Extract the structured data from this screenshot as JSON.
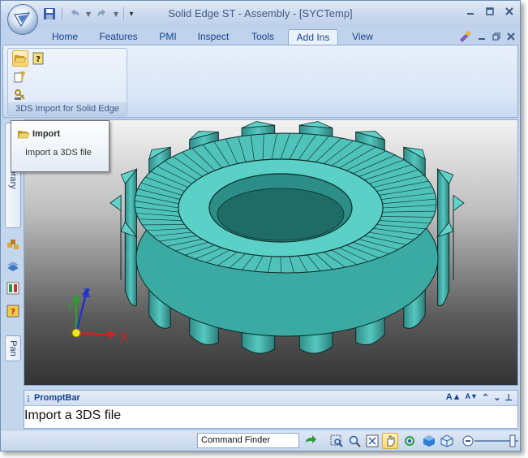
{
  "window": {
    "title": "Solid Edge ST - Assembly - [SYCTemp]"
  },
  "tabs": [
    {
      "label": "Home",
      "active": false
    },
    {
      "label": "Features",
      "active": false
    },
    {
      "label": "PMI",
      "active": false
    },
    {
      "label": "Inspect",
      "active": false
    },
    {
      "label": "Tools",
      "active": false
    },
    {
      "label": "Add Ins",
      "active": true
    },
    {
      "label": "View",
      "active": false
    }
  ],
  "ribbon": {
    "group_label": "3DS Import for Solid Edge",
    "buttons": [
      {
        "icon": "folder-open-icon"
      },
      {
        "icon": "help-icon"
      },
      {
        "icon": "help-page-icon"
      },
      {
        "icon": "key-icon"
      }
    ]
  },
  "tooltip": {
    "title": "Import",
    "description": "Import a 3DS file"
  },
  "left_panel": {
    "tab_library": "Library",
    "tab_pan": "Pan"
  },
  "triad": {
    "x": "X",
    "y": "Y",
    "z": "Z"
  },
  "promptbar": {
    "title": "PromptBar",
    "text": "Import a 3DS file",
    "font_up": "A",
    "font_down": "A"
  },
  "statusbar": {
    "command_finder": "Command Finder"
  },
  "colors": {
    "accent": "#15428b",
    "gear": "#3fb8b0",
    "axis_x": "#d42020",
    "axis_y": "#2aa02a",
    "axis_z": "#2233cc"
  }
}
